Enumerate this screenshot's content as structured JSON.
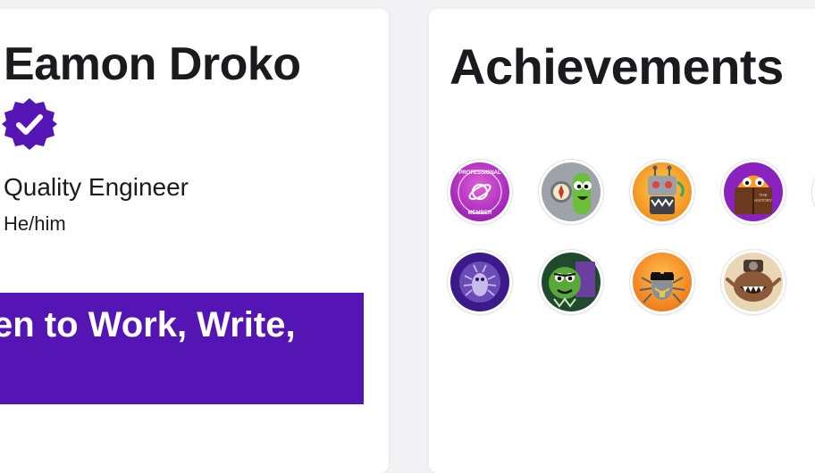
{
  "profile": {
    "name": "Eamon Droko",
    "verified_icon": "verified-badge-icon",
    "job_title": "Quality Engineer",
    "pronouns": "He/him",
    "banner_text": "en to Work, Write,"
  },
  "achievements": {
    "heading": "Achievements",
    "badges": [
      {
        "icon": "professional-member-badge-icon",
        "text": [
          "PROFESSIONAL",
          "MEMBER"
        ]
      },
      {
        "icon": "compass-explorer-badge-icon"
      },
      {
        "icon": "robot-badge-icon"
      },
      {
        "icon": "book-reader-badge-icon",
        "text": [
          "THE",
          "HISTORY"
        ]
      },
      {
        "icon": "bug-badge-icon"
      },
      {
        "icon": "monster-badge-icon"
      },
      {
        "icon": "sunglasses-spider-badge-icon"
      },
      {
        "icon": "camera-monster-badge-icon"
      }
    ]
  },
  "colors": {
    "accent": "#5514b4",
    "card": "#ffffff",
    "page": "#f2f2f5"
  }
}
